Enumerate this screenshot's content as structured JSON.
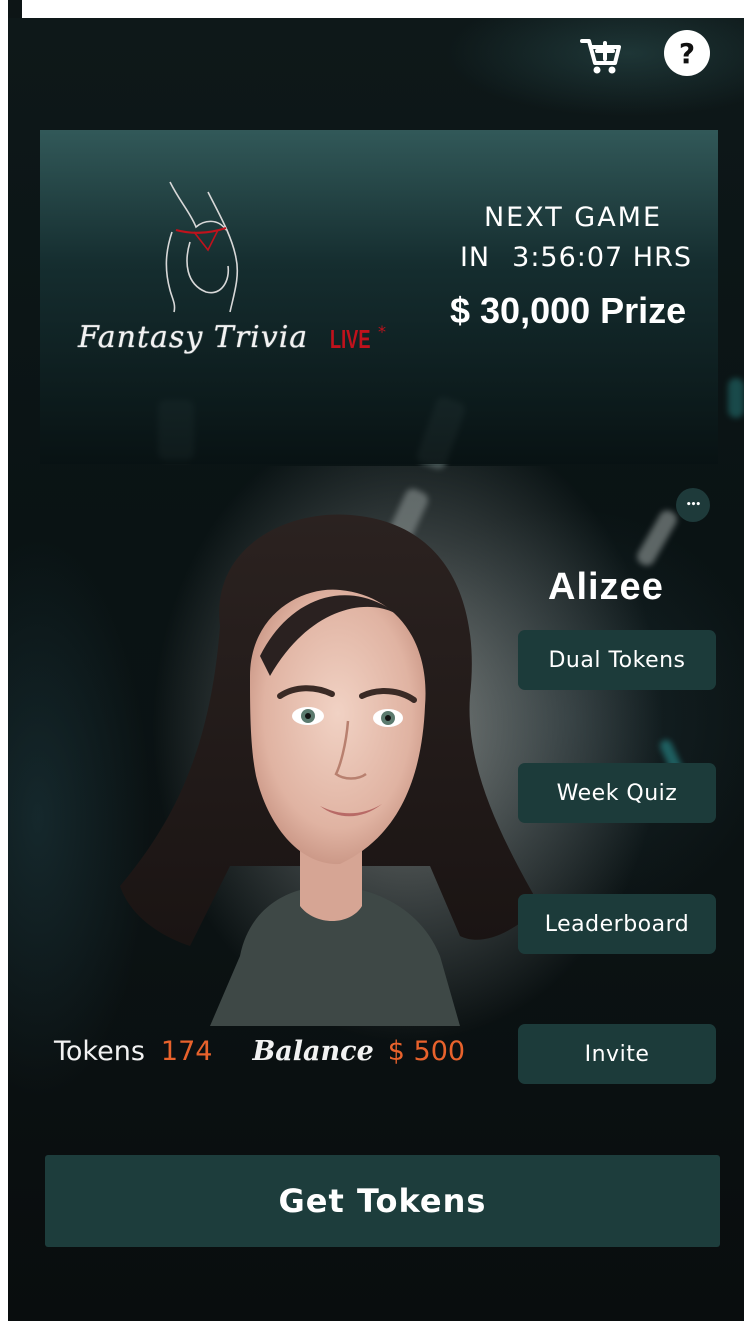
{
  "header": {
    "cart_icon": "cart-plus-icon",
    "help_icon": "question-icon",
    "help_glyph": "?"
  },
  "banner": {
    "logo_text": "Fantasy Trivia",
    "logo_live": "LIVE",
    "logo_star": "*",
    "next_game_label": "NEXT GAME",
    "next_in_label": "IN",
    "countdown": "3:56:07 HRS",
    "prize": "$ 30,000 Prize"
  },
  "profile": {
    "more_glyph": "•••",
    "name": "Alizee",
    "actions": {
      "dual_tokens": "Dual Tokens",
      "week_quiz": "Week Quiz",
      "leaderboard": "Leaderboard",
      "invite": "Invite"
    },
    "stats": {
      "tokens_label": "Tokens",
      "tokens_value": "174",
      "balance_label": "Balance",
      "balance_value": "$ 500"
    }
  },
  "footer": {
    "get_tokens": "Get Tokens"
  },
  "colors": {
    "accent_button": "#1c3b3a",
    "value_orange": "#e8622c",
    "logo_red": "#c0121c"
  }
}
